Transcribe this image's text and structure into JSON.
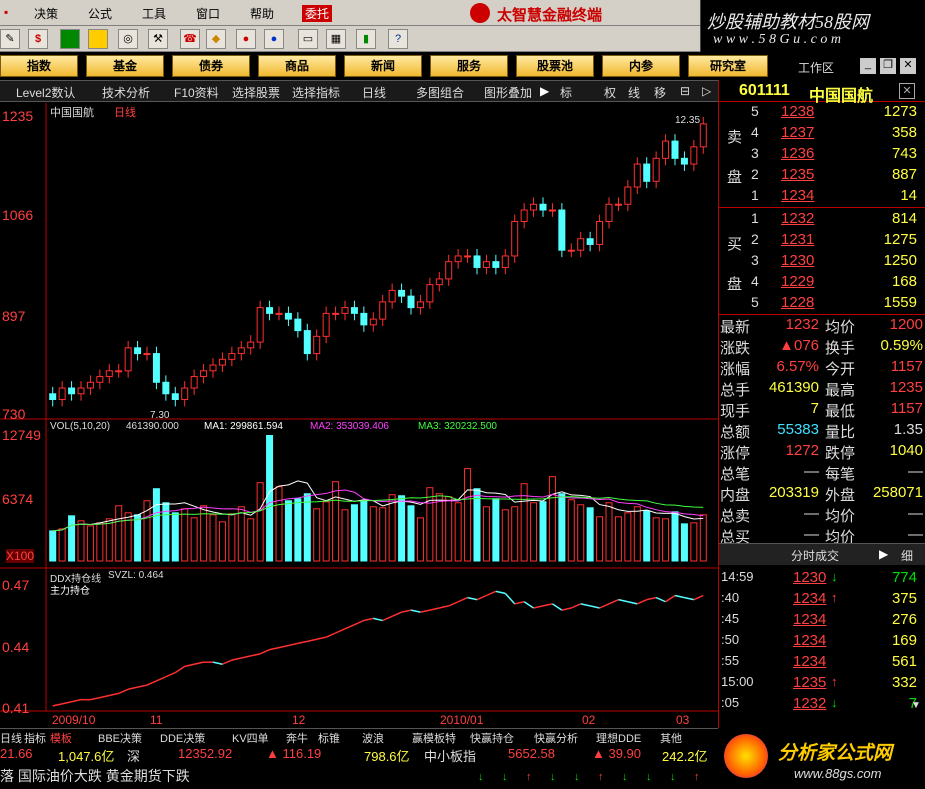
{
  "menu": [
    "决策",
    "公式",
    "工具",
    "窗口",
    "帮助",
    "委托"
  ],
  "menu_prefix": "",
  "brand": {
    "title": "太智慧金融终端",
    "slogan": "炒股辅助教材58股网",
    "url": "w w w . 5 8 G u . c o m"
  },
  "nav_buttons": [
    "指数",
    "基金",
    "债券",
    "商品",
    "新闻",
    "服务",
    "股票池",
    "内参",
    "研究室"
  ],
  "workspace_label": "工作区",
  "subbar": [
    "Level2数认",
    "技术分析",
    "F10资料",
    "选择股票",
    "选择指标",
    "日线",
    "多图组合",
    "图形叠加",
    "标",
    "权",
    "线",
    "移"
  ],
  "chart_header": {
    "name": "中国国航",
    "period": "日线"
  },
  "price_axis": [
    "1235",
    "1066",
    "897",
    "730"
  ],
  "price_marks": {
    "low": "7.30",
    "high": "12.35"
  },
  "vol_header": {
    "label": "VOL(5,10,20)",
    "val": "461390.000",
    "ma1": "MA1: 299861.594",
    "ma2": "MA2: 353039.406",
    "ma3": "MA3: 320232.500"
  },
  "vol_axis": [
    "12749",
    "6374",
    "X100"
  ],
  "ddx_header": {
    "label": "DDX持仓线",
    "svzl": "SVZL: 0.464",
    "sub": "主力持仓"
  },
  "ddx_axis": [
    "0.47",
    "0.44",
    "0.41"
  ],
  "date_axis": [
    "2009/10",
    "11",
    "12",
    "2010/01",
    "02",
    "03"
  ],
  "colors": {
    "up": "#ff3030",
    "down": "#54ffff",
    "ma1": "#ffffff",
    "ma2": "#ff40ff",
    "ma3": "#40ff40"
  },
  "chart_data": {
    "type": "candlestick",
    "opens": [
      7.6,
      7.5,
      7.7,
      7.6,
      7.7,
      7.8,
      7.9,
      8.0,
      8.0,
      8.4,
      8.3,
      8.3,
      7.8,
      7.6,
      7.5,
      7.7,
      7.9,
      8.0,
      8.1,
      8.2,
      8.3,
      8.4,
      8.5,
      9.1,
      9.0,
      9.0,
      8.9,
      8.7,
      8.3,
      8.6,
      9.0,
      9.0,
      9.1,
      9.0,
      8.8,
      8.9,
      9.2,
      9.4,
      9.3,
      9.1,
      9.2,
      9.5,
      9.6,
      9.9,
      10.0,
      10.0,
      9.8,
      9.9,
      9.8,
      10.0,
      10.6,
      10.8,
      10.9,
      10.8,
      10.8,
      10.1,
      10.1,
      10.3,
      10.2,
      10.6,
      10.9,
      10.9,
      11.2,
      11.6,
      11.3,
      11.7,
      12.0,
      11.7,
      11.6,
      11.9
    ],
    "closes": [
      7.5,
      7.7,
      7.6,
      7.7,
      7.8,
      7.9,
      8.0,
      8.0,
      8.4,
      8.3,
      8.3,
      7.8,
      7.6,
      7.5,
      7.7,
      7.9,
      8.0,
      8.1,
      8.2,
      8.3,
      8.4,
      8.5,
      9.1,
      9.0,
      9.0,
      8.9,
      8.7,
      8.3,
      8.6,
      9.0,
      9.0,
      9.1,
      9.0,
      8.8,
      8.9,
      9.2,
      9.4,
      9.3,
      9.1,
      9.2,
      9.5,
      9.6,
      9.9,
      10.0,
      10.0,
      9.8,
      9.9,
      9.8,
      10.0,
      10.6,
      10.8,
      10.9,
      10.8,
      10.8,
      10.1,
      10.1,
      10.3,
      10.2,
      10.6,
      10.9,
      10.9,
      11.2,
      11.6,
      11.3,
      11.7,
      12.0,
      11.7,
      11.6,
      11.9,
      12.3
    ],
    "volumes": [
      3000,
      3200,
      4500,
      4000,
      3500,
      3800,
      4200,
      5500,
      4800,
      4600,
      6000,
      7200,
      5800,
      4800,
      5200,
      4300,
      5500,
      4600,
      3900,
      4700,
      5400,
      4200,
      7800,
      12500,
      7400,
      6000,
      6200,
      6700,
      5200,
      5900,
      7900,
      5100,
      5600,
      6000,
      5400,
      5300,
      6600,
      6500,
      5500,
      4300,
      7300,
      6700,
      6400,
      5800,
      9200,
      7200,
      5400,
      6200,
      5100,
      5400,
      7700,
      5800,
      5900,
      8400,
      6700,
      6100,
      5600,
      5300,
      4400,
      5800,
      4400,
      4800,
      5400,
      5000,
      4300,
      4200,
      4900,
      3700,
      3800,
      4600
    ],
    "ddx": [
      0.411,
      0.412,
      0.413,
      0.414,
      0.414,
      0.415,
      0.416,
      0.417,
      0.419,
      0.42,
      0.421,
      0.423,
      0.425,
      0.427,
      0.43,
      0.431,
      0.432,
      0.432,
      0.431,
      0.433,
      0.434,
      0.435,
      0.436,
      0.438,
      0.439,
      0.44,
      0.441,
      0.442,
      0.443,
      0.444,
      0.446,
      0.448,
      0.45,
      0.452,
      0.453,
      0.452,
      0.454,
      0.456,
      0.457,
      0.456,
      0.457,
      0.458,
      0.459,
      0.461,
      0.463,
      0.462,
      0.464,
      0.466,
      0.465,
      0.46,
      0.461,
      0.458,
      0.459,
      0.46,
      0.457,
      0.458,
      0.46,
      0.459,
      0.458,
      0.46,
      0.462,
      0.461,
      0.46,
      0.462,
      0.463,
      0.461,
      0.464,
      0.463,
      0.462,
      0.464
    ],
    "price_range": [
      7.3,
      12.35
    ],
    "vol_range": [
      0,
      12749
    ],
    "ddx_range": [
      0.41,
      0.47
    ]
  },
  "quote": {
    "code": "601111",
    "name": "中国国航",
    "sell_label": [
      "卖",
      "盘"
    ],
    "buy_label": [
      "买",
      "盘"
    ],
    "sells": [
      {
        "n": "5",
        "p": "1238",
        "v": "1273"
      },
      {
        "n": "4",
        "p": "1237",
        "v": "358"
      },
      {
        "n": "3",
        "p": "1236",
        "v": "743"
      },
      {
        "n": "2",
        "p": "1235",
        "v": "887"
      },
      {
        "n": "1",
        "p": "1234",
        "v": "14"
      }
    ],
    "buys": [
      {
        "n": "1",
        "p": "1232",
        "v": "814"
      },
      {
        "n": "2",
        "p": "1231",
        "v": "1275"
      },
      {
        "n": "3",
        "p": "1230",
        "v": "1250"
      },
      {
        "n": "4",
        "p": "1229",
        "v": "168"
      },
      {
        "n": "5",
        "p": "1228",
        "v": "1559"
      }
    ],
    "stats": [
      {
        "l1": "最新",
        "v1": "1232",
        "l2": "均价",
        "v2": "1200"
      },
      {
        "l1": "涨跌",
        "v1": "▲076",
        "l2": "换手",
        "v2": "0.59%"
      },
      {
        "l1": "涨幅",
        "v1": "6.57%",
        "l2": "今开",
        "v2": "1157"
      },
      {
        "l1": "总手",
        "v1": "461390",
        "l2": "最高",
        "v2": "1235"
      },
      {
        "l1": "现手",
        "v1": "7",
        "l2": "最低",
        "v2": "1157"
      },
      {
        "l1": "总额",
        "v1": "55383",
        "l2": "量比",
        "v2": "1.35"
      },
      {
        "l1": "涨停",
        "v1": "1272",
        "l2": "跌停",
        "v2": "1040"
      },
      {
        "l1": "总笔",
        "v1": "—",
        "l2": "每笔",
        "v2": "—"
      },
      {
        "l1": "内盘",
        "v1": "203319",
        "l2": "外盘",
        "v2": "258071"
      },
      {
        "l1": "总卖",
        "v1": "—",
        "l2": "均价",
        "v2": "—"
      },
      {
        "l1": "总买",
        "v1": "—",
        "l2": "均价",
        "v2": "—"
      }
    ],
    "ticks_title": "分时成交",
    "ticks_btn": "细",
    "ticks": [
      {
        "t": "14:59",
        "p": "1230",
        "d": "↓",
        "v": "774"
      },
      {
        "t": ":40",
        "p": "1234",
        "d": "↑",
        "v": "375"
      },
      {
        "t": ":45",
        "p": "1234",
        "d": "",
        "v": "276"
      },
      {
        "t": ":50",
        "p": "1234",
        "d": "",
        "v": "169"
      },
      {
        "t": ":55",
        "p": "1234",
        "d": "",
        "v": "561"
      },
      {
        "t": "15:00",
        "p": "1235",
        "d": "↑",
        "v": "332"
      },
      {
        "t": ":05",
        "p": "1232",
        "d": "↓",
        "v": "7"
      }
    ]
  },
  "bottom_tabs": [
    "日线",
    "指标",
    "模板",
    "BBE决策",
    "DDE决策",
    "KV四单",
    "奔牛",
    "标锥",
    "波浪",
    "赢模板特",
    "快赢持仓",
    "快赢分析",
    "理想DDE",
    "其他"
  ],
  "index_bar": [
    "21.66",
    "1,047.6亿",
    "深",
    "12352.92",
    "▲ 116.19",
    "798.6亿",
    "中小板指",
    "5652.58",
    "▲ 39.90",
    "242.2亿"
  ],
  "news": "落 国际油价大跌 黄金期货下跌",
  "logo88": {
    "title": "分析家公式网",
    "url": "www.88gs.com"
  }
}
